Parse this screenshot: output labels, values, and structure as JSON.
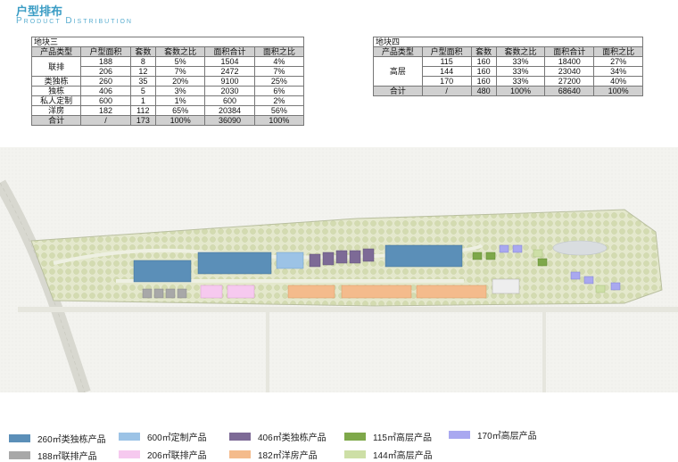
{
  "header": {
    "title": "户型排布",
    "subtitle": "Product Distribution"
  },
  "table_a": {
    "caption": "地块三",
    "columns": [
      "产品类型",
      "户型面积",
      "套数",
      "套数之比",
      "面积合计",
      "面积之比"
    ],
    "rows": [
      {
        "type": "联排",
        "area": "188",
        "count": "8",
        "count_ratio": "5%",
        "total": "1504",
        "area_ratio": "4%"
      },
      {
        "type": "",
        "area": "206",
        "count": "12",
        "count_ratio": "7%",
        "total": "2472",
        "area_ratio": "7%"
      },
      {
        "type": "类独栋",
        "area": "260",
        "count": "35",
        "count_ratio": "20%",
        "total": "9100",
        "area_ratio": "25%"
      },
      {
        "type": "独栋",
        "area": "406",
        "count": "5",
        "count_ratio": "3%",
        "total": "2030",
        "area_ratio": "6%"
      },
      {
        "type": "私人定制",
        "area": "600",
        "count": "1",
        "count_ratio": "1%",
        "total": "600",
        "area_ratio": "2%"
      },
      {
        "type": "洋房",
        "area": "182",
        "count": "112",
        "count_ratio": "65%",
        "total": "20384",
        "area_ratio": "56%"
      }
    ],
    "total": {
      "type": "合计",
      "area": "/",
      "count": "173",
      "count_ratio": "100%",
      "total": "36090",
      "area_ratio": "100%"
    }
  },
  "table_b": {
    "caption": "地块四",
    "columns": [
      "产品类型",
      "户型面积",
      "套数",
      "套数之比",
      "面积合计",
      "面积之比"
    ],
    "rows": [
      {
        "type": "高层",
        "area": "115",
        "count": "160",
        "count_ratio": "33%",
        "total": "18400",
        "area_ratio": "27%"
      },
      {
        "type": "",
        "area": "144",
        "count": "160",
        "count_ratio": "33%",
        "total": "23040",
        "area_ratio": "34%"
      },
      {
        "type": "",
        "area": "170",
        "count": "160",
        "count_ratio": "33%",
        "total": "27200",
        "area_ratio": "40%"
      }
    ],
    "total": {
      "type": "合计",
      "area": "/",
      "count": "480",
      "count_ratio": "100%",
      "total": "68640",
      "area_ratio": "100%"
    }
  },
  "legend": [
    {
      "label": "260㎡类独栋产品",
      "color": "#5b8fb8"
    },
    {
      "label": "600㎡定制产品",
      "color": "#9cc3e6"
    },
    {
      "label": "406㎡类独栋产品",
      "color": "#7d6a96"
    },
    {
      "label": "115㎡高层产品",
      "color": "#7ea84a"
    },
    {
      "label": "170㎡高层产品",
      "color": "#a9a8f0"
    },
    {
      "label": "188㎡联排产品",
      "color": "#a8a8a8"
    },
    {
      "label": "206㎡联排产品",
      "color": "#f6c9ef"
    },
    {
      "label": "182㎡洋房产品",
      "color": "#f4bb8c"
    },
    {
      "label": "144㎡高层产品",
      "color": "#cddfa6"
    }
  ]
}
